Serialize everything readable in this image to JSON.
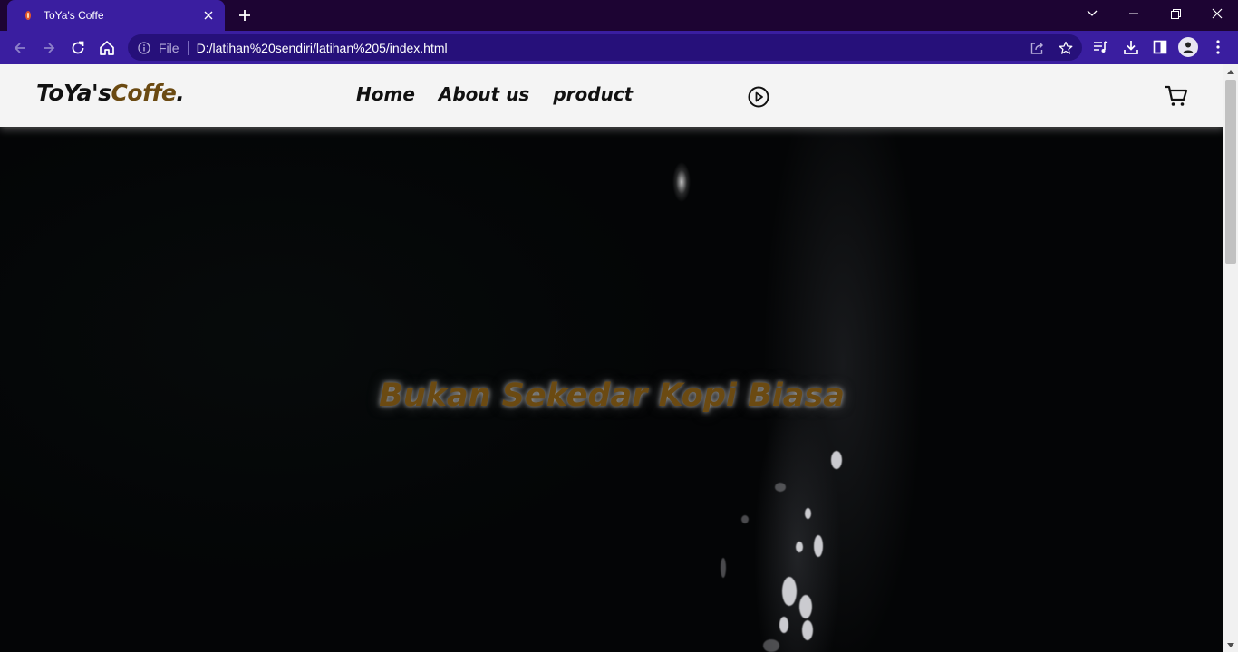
{
  "browser": {
    "tab": {
      "title": "ToYa's Coffe",
      "favicon": "flame-favicon-icon"
    },
    "address": {
      "scheme_label": "File",
      "url": "D:/latihan%20sendiri/latihan%205/index.html"
    },
    "icons": [
      "back-icon",
      "forward-icon",
      "reload-icon",
      "home-icon",
      "info-icon",
      "share-icon",
      "star-icon",
      "media-icon",
      "download-icon",
      "side-panel-icon",
      "profile-icon",
      "menu-icon",
      "minimize-icon",
      "restore-icon",
      "close-icon",
      "new-tab-icon",
      "tab-list-icon"
    ],
    "colors": {
      "tabstrip": "#1d0433",
      "toolbar": "#3a1ea0",
      "omnibox": "#26107a"
    }
  },
  "site": {
    "logo": {
      "main": "ToYa's",
      "accent": "Coffe",
      "dot": "."
    },
    "nav": [
      {
        "label": "Home"
      },
      {
        "label": "About us"
      },
      {
        "label": "product"
      }
    ],
    "icons": {
      "play": "play-circle-icon",
      "cart": "shopping-cart-icon"
    },
    "hero": {
      "tagline": "Bukan Sekedar Kopi Biasa"
    },
    "colors": {
      "accent": "#6b4a12",
      "navbar_bg": "#f4f4f4",
      "hero_bg": "#040506"
    }
  }
}
